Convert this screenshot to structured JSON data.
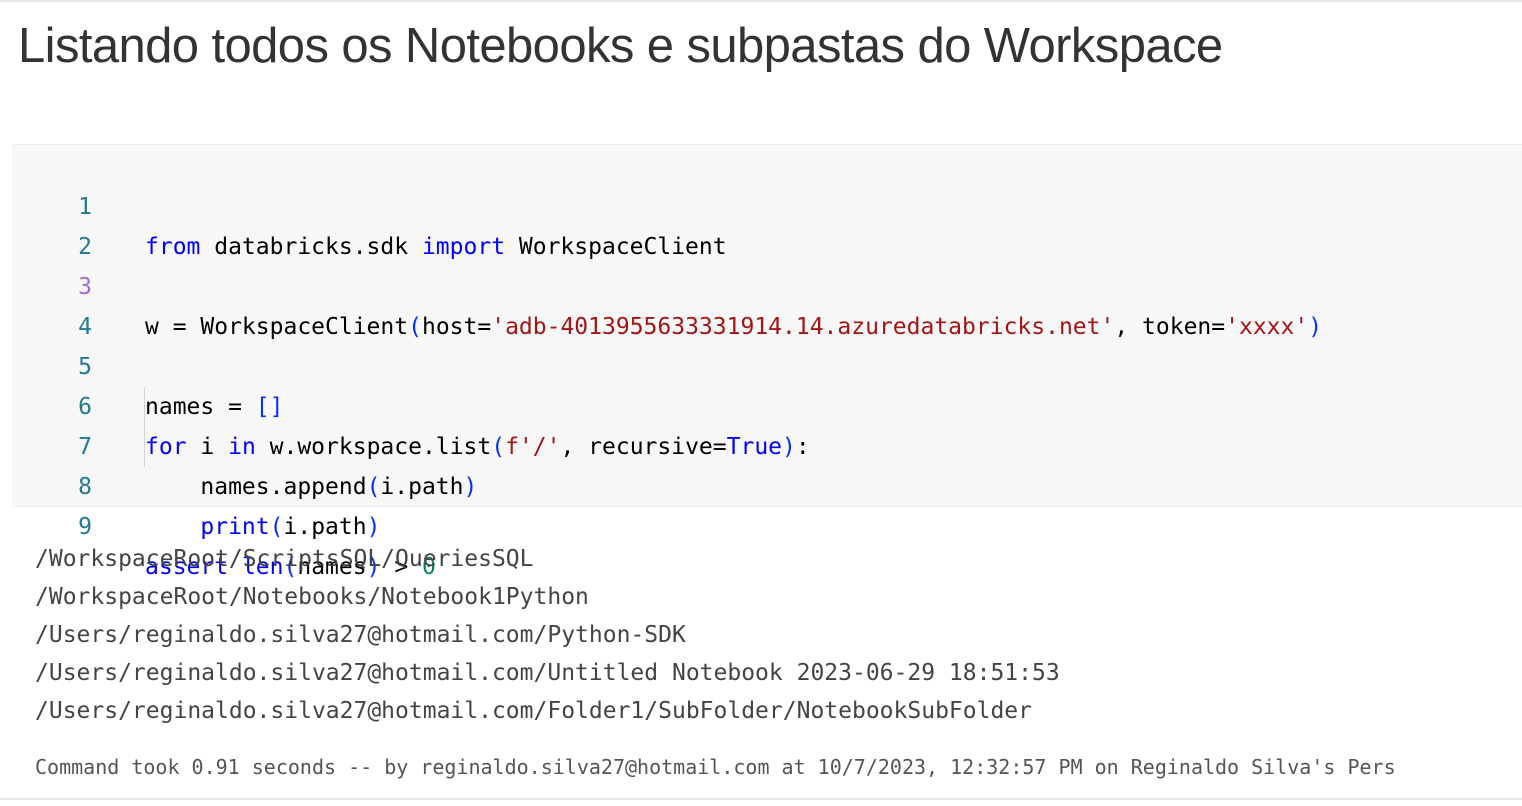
{
  "title": "Listando todos os Notebooks e subpastas do Workspace",
  "code": {
    "line_numbers": [
      "1",
      "2",
      "3",
      "4",
      "5",
      "6",
      "7",
      "8",
      "9"
    ],
    "l1": {
      "kw1": "from",
      "t1": " databricks.sdk ",
      "kw2": "import",
      "t2": " WorkspaceClient"
    },
    "l3": {
      "t1": "w = WorkspaceClient",
      "p1": "(",
      "t2": "host=",
      "s1": "'adb-4013955633331914.14.azuredatabricks.net'",
      "t3": ", token=",
      "s2": "'xxxx'",
      "p2": ")"
    },
    "l5": {
      "t1": "names = ",
      "p1": "[]"
    },
    "l6": {
      "kw1": "for",
      "t1": " i ",
      "kw2": "in",
      "t2": " w.workspace.list",
      "p1": "(",
      "s1": "f'/'",
      "t3": ", recursive=",
      "kw3": "True",
      "p2": ")",
      "t4": ":"
    },
    "l7": {
      "t1": "    names.append",
      "p1": "(",
      "t2": "i.path",
      "p2": ")"
    },
    "l8": {
      "t0": "    ",
      "kw1": "print",
      "p1": "(",
      "t2": "i.path",
      "p2": ")"
    },
    "l9": {
      "kw1": "assert",
      "t0": " ",
      "kw2": "len",
      "p1": "(",
      "t2": "names",
      "p2": ")",
      "t3": " > ",
      "n1": "0"
    }
  },
  "output_lines": [
    "/WorkspaceRoot/ScriptsSQL/QueriesSQL",
    "/WorkspaceRoot/Notebooks/Notebook1Python",
    "/Users/reginaldo.silva27@hotmail.com/Python-SDK",
    "/Users/reginaldo.silva27@hotmail.com/Untitled Notebook 2023-06-29 18:51:53",
    "/Users/reginaldo.silva27@hotmail.com/Folder1/SubFolder/NotebookSubFolder"
  ],
  "command_info": "Command took 0.91 seconds -- by reginaldo.silva27@hotmail.com at 10/7/2023, 12:32:57 PM on Reginaldo Silva's Pers",
  "colors": {
    "keyword": "#0000ff",
    "string": "#a31515",
    "number": "#098658",
    "bracket": "#0431fa",
    "line_number": "#237893",
    "active_line_number": "#a06bd6",
    "code_background": "#f7f7f7"
  }
}
